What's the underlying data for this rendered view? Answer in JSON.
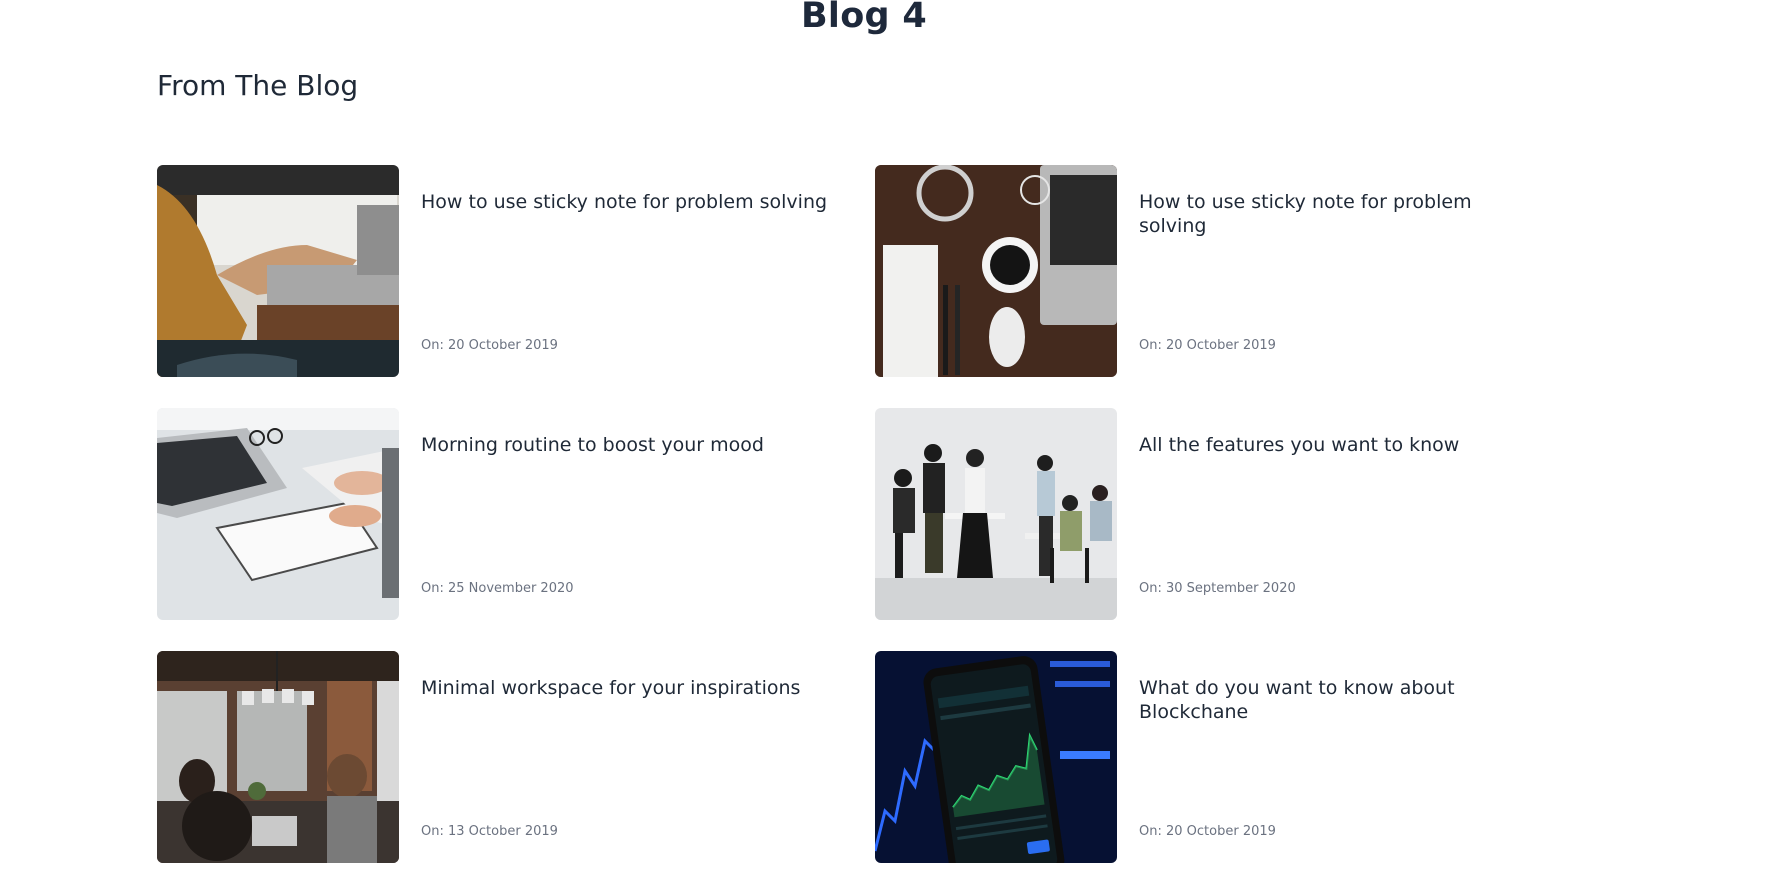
{
  "page": {
    "title": "Blog 4",
    "section_title": "From The Blog"
  },
  "posts": [
    {
      "title": "How to use sticky note for problem solving",
      "date": "On: 20 October 2019",
      "image_icon": "laptop-typing-photo"
    },
    {
      "title": "How to use sticky note for problem solving",
      "date": "On: 20 October 2019",
      "image_icon": "desk-coffee-photo"
    },
    {
      "title": "Morning routine to boost your mood",
      "date": "On: 25 November 2020",
      "image_icon": "notebook-desk-photo"
    },
    {
      "title": "All the features you want to know",
      "date": "On: 30 September 2020",
      "image_icon": "team-meeting-photo"
    },
    {
      "title": "Minimal workspace for your inspirations",
      "date": "On: 13 October 2019",
      "image_icon": "cafe-workspace-photo"
    },
    {
      "title": "What do you want to know about Blockchane",
      "date": "On: 20 October 2019",
      "image_icon": "phone-chart-photo"
    }
  ],
  "colors": {
    "heading": "#1e293b",
    "text": "#1f2937",
    "muted": "#6b7280"
  }
}
